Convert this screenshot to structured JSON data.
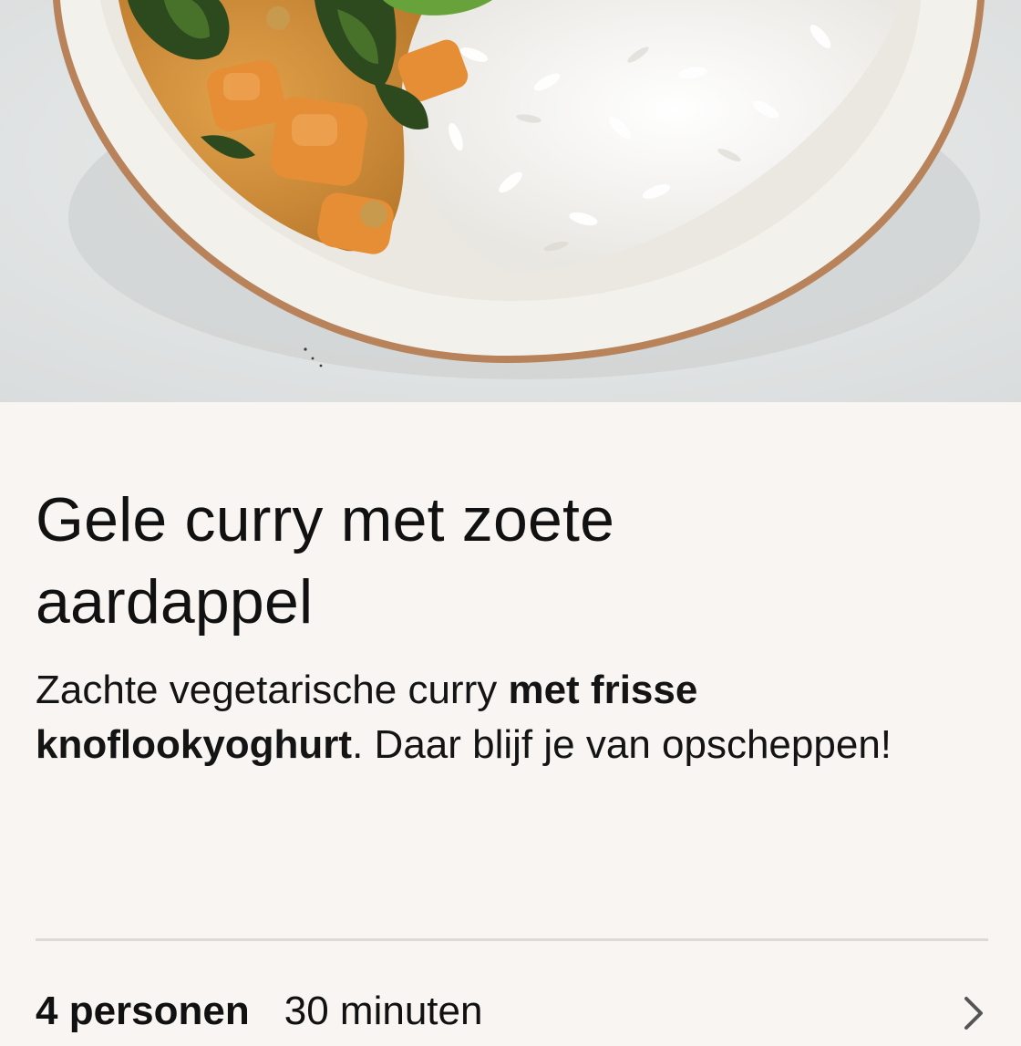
{
  "hero": {
    "image": "curry-bowl-photo"
  },
  "recipe": {
    "title": "Gele curry met zoete aardappel",
    "subtitle_parts": {
      "intro": "Zachte vegetarische curry ",
      "highlight": "met frisse knoflookyoghurt",
      "outro": ". Daar blijf je van opscheppen!"
    },
    "servings": "4 personen",
    "time": "30 minuten"
  },
  "icons": {
    "details": "chevron-right-icon"
  },
  "colors": {
    "background": "#f8f5f2",
    "text": "#111111",
    "divider": "#dcdad7"
  }
}
